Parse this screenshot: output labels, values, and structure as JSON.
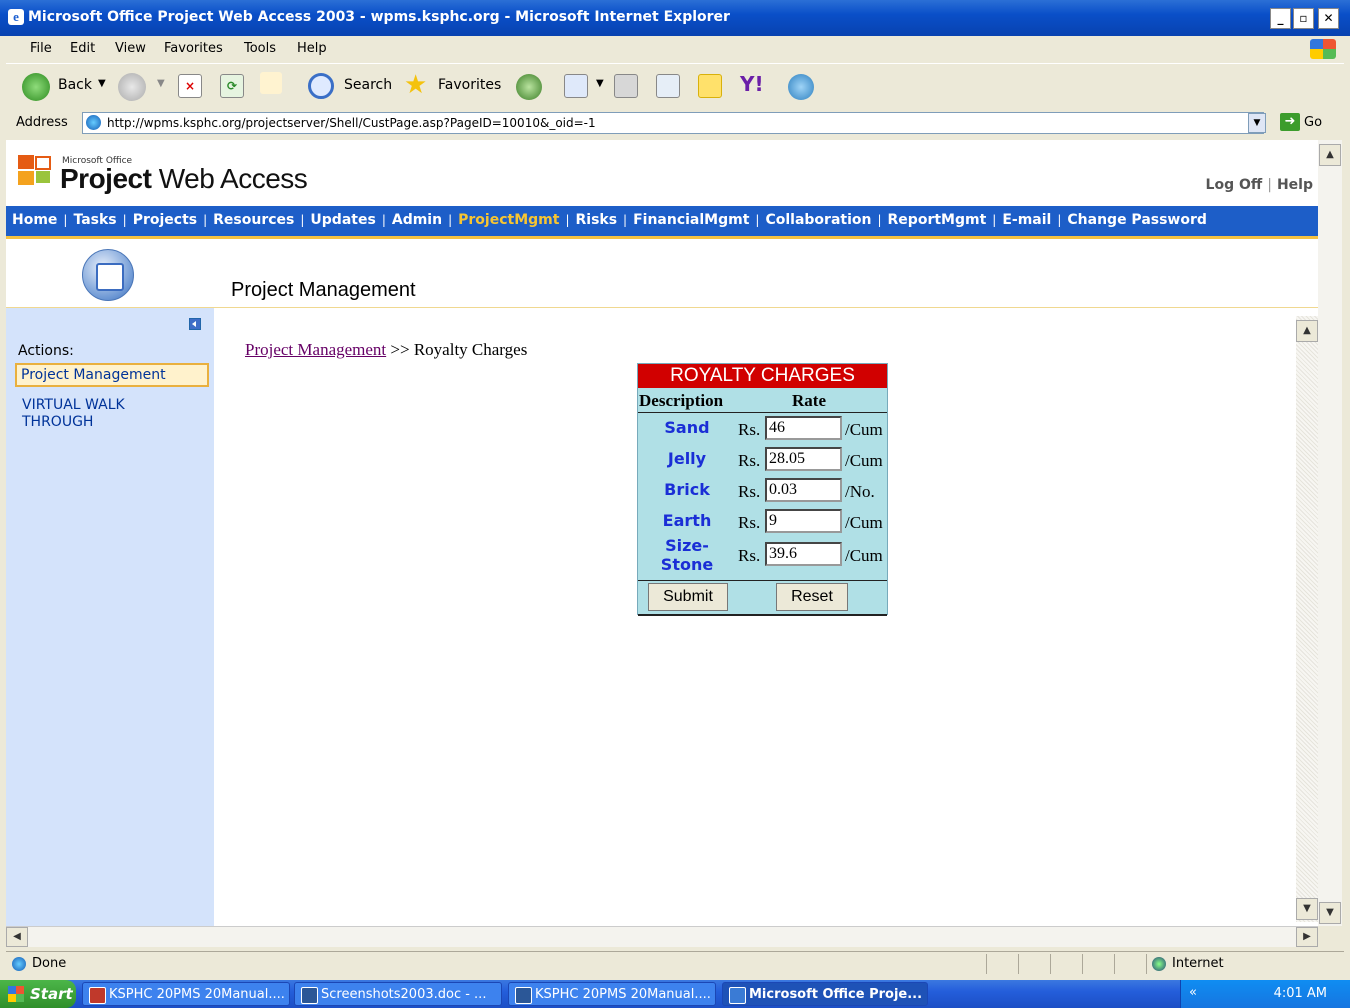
{
  "window": {
    "title": "Microsoft Office Project Web Access 2003 - wpms.ksphc.org - Microsoft Internet Explorer",
    "controls": [
      "_",
      "&#8206;",
      "×"
    ]
  },
  "menubar": [
    "File",
    "Edit",
    "View",
    "Favorites",
    "Tools",
    "Help"
  ],
  "toolbar": {
    "back": "Back",
    "search": "Search",
    "favorites": "Favorites"
  },
  "address": {
    "label": "Address",
    "url": "http://wpms.ksphc.org/projectserver/Shell/CustPage.asp?PageID=10010&_oid=-1",
    "go": "Go"
  },
  "pwa": {
    "logo_small": "Microsoft Office",
    "logo_project": "Project",
    "logo_rest": " Web Access",
    "log_off": "Log Off",
    "help": "Help",
    "nav": [
      {
        "label": "Home"
      },
      {
        "label": "Tasks"
      },
      {
        "label": "Projects"
      },
      {
        "label": "Resources"
      },
      {
        "label": "Updates"
      },
      {
        "label": "Admin"
      },
      {
        "label": "ProjectMgmt",
        "active": true
      },
      {
        "label": "Risks"
      },
      {
        "label": "FinancialMgmt"
      },
      {
        "label": "Collaboration"
      },
      {
        "label": "ReportMgmt"
      },
      {
        "label": "E-mail"
      },
      {
        "label": "Change Password"
      }
    ],
    "section_title": "Project Management"
  },
  "sidebar": {
    "actions_label": "Actions:",
    "items": [
      {
        "label": "Project Management",
        "selected": true
      },
      {
        "label": "VIRTUAL WALK THROUGH"
      }
    ]
  },
  "breadcrumb": {
    "link": "Project Management",
    "separator": " >> ",
    "current": "Royalty Charges"
  },
  "royalty": {
    "title": "ROYALTY CHARGES",
    "col_description": "Description",
    "col_rate": "Rate",
    "currency": "Rs.",
    "rows": [
      {
        "name": "Sand",
        "value": "46",
        "unit": "/Cum"
      },
      {
        "name": "Jelly",
        "value": "28.05",
        "unit": "/Cum"
      },
      {
        "name": "Brick",
        "value": "0.03",
        "unit": "/No."
      },
      {
        "name": "Earth",
        "value": "9",
        "unit": "/Cum"
      },
      {
        "name": "Size-Stone",
        "value": "39.6",
        "unit": "/Cum"
      }
    ],
    "submit": "Submit",
    "reset": "Reset"
  },
  "status": {
    "text": "Done",
    "zone": "Internet"
  },
  "taskbar": {
    "start": "Start",
    "tasks": [
      {
        "label": "KSPHC 20PMS 20Manual....",
        "icon_color": "#c0392b"
      },
      {
        "label": "Screenshots2003.doc - ...",
        "icon_color": "#2b5797"
      },
      {
        "label": "KSPHC 20PMS 20Manual....",
        "icon_color": "#2b5797"
      },
      {
        "label": "Microsoft Office Proje...",
        "icon_color": "#3a7bd5",
        "active": true
      }
    ],
    "tray_chevron": "«",
    "clock": "4:01 AM"
  }
}
